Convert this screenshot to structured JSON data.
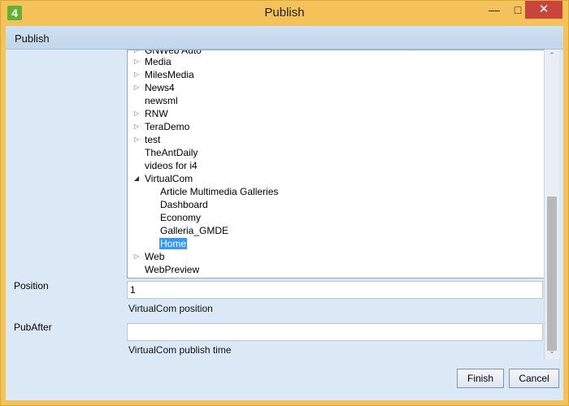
{
  "window": {
    "title": "Publish",
    "app_icon_text": "4"
  },
  "header": {
    "title": "Publish"
  },
  "tree": {
    "items": [
      {
        "label": "GNWeb Auto",
        "expander": "▷"
      },
      {
        "label": "Media",
        "expander": "▷"
      },
      {
        "label": "MilesMedia",
        "expander": "▷"
      },
      {
        "label": "News4",
        "expander": "▷"
      },
      {
        "label": "newsml",
        "expander": ""
      },
      {
        "label": "RNW",
        "expander": "▷"
      },
      {
        "label": "TeraDemo",
        "expander": "▷"
      },
      {
        "label": "test",
        "expander": "▷"
      },
      {
        "label": "TheAntDaily",
        "expander": ""
      },
      {
        "label": "videos for i4",
        "expander": ""
      },
      {
        "label": "VirtualCom",
        "expander": "◢"
      },
      {
        "label": "Article Multimedia Galleries",
        "expander": ""
      },
      {
        "label": "Dashboard",
        "expander": ""
      },
      {
        "label": "Economy",
        "expander": ""
      },
      {
        "label": "Galleria_GMDE",
        "expander": ""
      },
      {
        "label": "Home",
        "expander": ""
      },
      {
        "label": "Web",
        "expander": "▷"
      },
      {
        "label": "WebPreview",
        "expander": ""
      }
    ],
    "selected": "Home"
  },
  "position": {
    "label": "Position",
    "value": "1",
    "hint": "VirtualCom position"
  },
  "pubafter": {
    "label": "PubAfter",
    "value": "",
    "hint": "VirtualCom publish time"
  },
  "buttons": {
    "finish": "Finish",
    "cancel": "Cancel"
  },
  "colors": {
    "titlebar": "#f5c25a",
    "close": "#c7453b",
    "client": "#dbe9f6",
    "selection": "#3399ff"
  }
}
